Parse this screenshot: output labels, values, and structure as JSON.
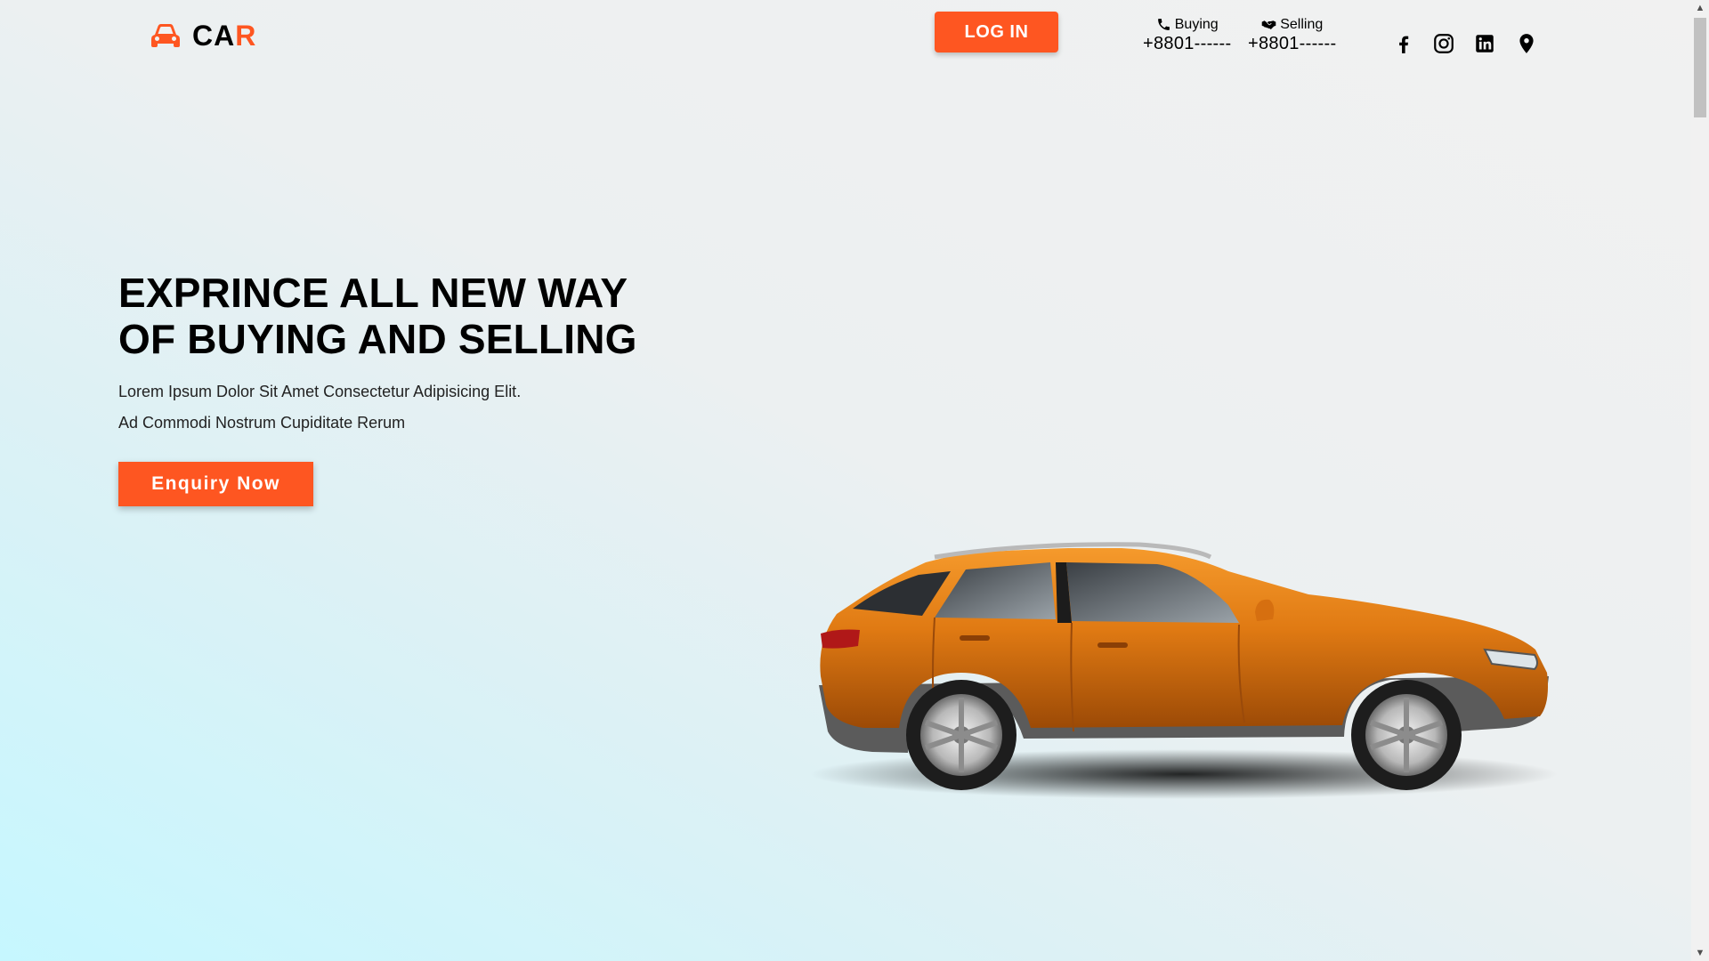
{
  "brand": {
    "name_main": "CA",
    "name_accent": "R",
    "icon": "car-icon",
    "accent_color": "#fe5621"
  },
  "header": {
    "login_label": "LOG IN",
    "contacts": [
      {
        "label": "Buying",
        "icon": "phone-icon",
        "number": "+8801------"
      },
      {
        "label": "Selling",
        "icon": "handshake-icon",
        "number": "+8801------"
      }
    ],
    "social": [
      "facebook-icon",
      "instagram-icon",
      "linkedin-icon",
      "location-pin-icon"
    ]
  },
  "hero": {
    "title": "EXPRINCE ALL NEW WAY OF BUYING AND SELLING",
    "line1": "Lorem Ipsum Dolor Sit Amet Consectetur Adipisicing Elit.",
    "line2": "Ad Commodi Nostrum Cupiditate Rerum",
    "cta_label": "Enquiry Now",
    "image": "orange-suv-car-image"
  },
  "scrollbar": {
    "up": "▲",
    "down": "▼"
  }
}
